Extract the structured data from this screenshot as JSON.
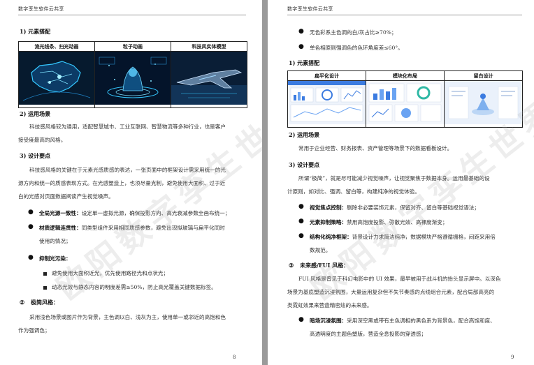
{
  "left": {
    "header": "数字孪生软件云共享",
    "page_number": "8",
    "s1_title": "1)   元素搭配",
    "figure_headers": [
      "流光线条、扫光动画",
      "粒子动画",
      "科技风实体模型"
    ],
    "s2_title": "2)   运用场景",
    "s2_lines": [
      "科技感风格较为通用，适配智慧城市、工业互联网、智慧物流等多种行业，也是客户",
      "接受度最高的风格。"
    ],
    "s3_title": "3)   设计要点",
    "s3_lines": [
      "科技感风格的关键在于元素光感质感的表达，一张页面中的框架设计需采用统一的光",
      "源方向和统一的质感表现方式。在光感塑造上，也须尽量克制，避免使用大面积、过于近",
      "白的光感对页面数据阅读产生视觉噪声。"
    ],
    "b1_label": "全局光源一致性：",
    "b1_text": "设定单一虚拟光源，确保投影方向、高光衰减参数全画布统一；",
    "b2_label": "材质逻辑连贯性：",
    "b2_text": "同类型组件采用相同质感参数，避免出现拟玻璃与扁平化同时",
    "b2_text2": "使用的情况；",
    "b3_label": "抑制光污染：",
    "sub1": "避免使用大面积近光，优先使用路径光和点状光；",
    "sub2": "动态光效与静态内容的明度差需≥50%，防止高光覆盖关键数据标签。",
    "circ_num": "②",
    "s4_title": "极简风格：",
    "s4_lines": [
      "采用浅色场景或图片作为背景，主色调以白、浅灰为主，使用单一或邻近的高饱和色",
      "作为强调色；"
    ]
  },
  "right": {
    "header": "数字孪生软件云共享",
    "page_number": "9",
    "top_b1": "无色彩系主色调的白/灰占比≥70%；",
    "top_b2": "单色相原则强调色的色环角度差≤60°。",
    "s1_title": "1)   元素搭配",
    "figure_headers": [
      "扁平化设计",
      "模块化布局",
      "留白设计"
    ],
    "s2_title": "2)   运用场景",
    "s2_lines": [
      "常用于企业经营、财务报表、资产管理等场景下的数据看板设计。"
    ],
    "s3_title": "3)   设计要点",
    "s3_lines": [
      "所谓“极简”，就是尽可能减少视觉噪声，让视觉聚焦于数据本身。运用最基础的设",
      "计原则，如对比、强调、留白等，构建纯净的视觉体验。"
    ],
    "b1_label": "视觉焦点控制：",
    "b1_text": "剔除非必要装饰元素，保留对齐、留白等基础视觉语法；",
    "b2_label": "元素抑制策略：",
    "b2_text": "禁用高饱度投影、弥散光效、高裸度渐变；",
    "b3_label": "结构化纯净框架：",
    "b3_text": "背景设计力求简洁纯净，数据模块严格遵循栅格，间距采用倍",
    "b3_text2": "数规范。",
    "circ_num": "③",
    "s4_title": "未来感/FUI 风格：",
    "s4_lines": [
      "FUI 风格是曾见于科幻电影中的 UI 效果，最早被用于战斗机的抬头显示屏中。以深色",
      "场景为基底塑造沉浸氛围，大量运用复杂但不失节奏感的点线组合元素，配合局部高亮的",
      "类霓虹效果来营造精密炫的未来感。"
    ],
    "b4_label": "暗场沉浸氛围：",
    "b4_text": "采用深空黑或带有主色调相的黑色系为背景色，配合高饱和度、",
    "b4_text2": "高透明度的主题色塑版，营造全息投影的穿透感；"
  },
  "watermark": "欧阳数字孪生世界",
  "colors": {
    "page_bg": "#ffffff",
    "gutter": "#9a9a9a",
    "dark_thumb_bg": "#061a2e",
    "glow_cyan": "#35c8ff",
    "light_dashboard_bg": "#e8f0fb",
    "accent_blue": "#3b7be0"
  }
}
